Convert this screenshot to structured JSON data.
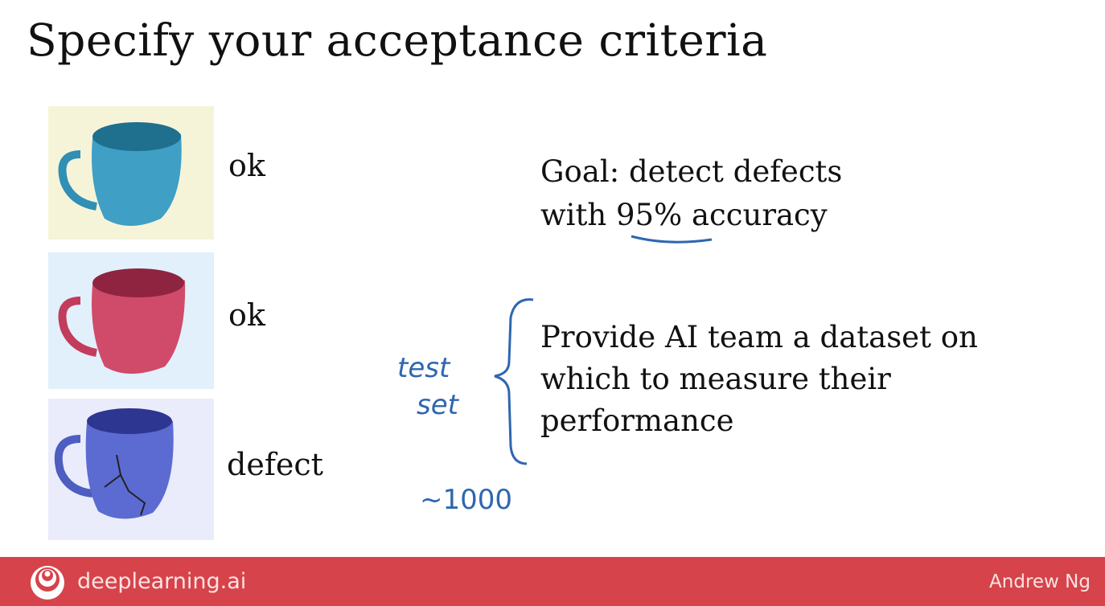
{
  "slide": {
    "title": "Specify your acceptance criteria",
    "examples": [
      {
        "label": "ok",
        "mug_color": "#3f9fc4",
        "background": "#f6f4d8"
      },
      {
        "label": "ok",
        "mug_color": "#d04a6a",
        "background": "#e1f0fb"
      },
      {
        "label": "defect",
        "mug_color": "#5b6bd2",
        "background": "#eaecfb"
      }
    ],
    "goal": {
      "line1": "Goal: detect defects",
      "line2_prefix": "with ",
      "line2_highlight": "95%",
      "line2_suffix": " accuracy"
    },
    "provide": {
      "line1": "Provide AI team a dataset on",
      "line2": "which to measure their",
      "line3": "performance"
    },
    "annotations": {
      "test": "test",
      "set": "set",
      "size": "~1000",
      "ink_color": "#2f66b0"
    }
  },
  "footer": {
    "brand": "deeplearning.ai",
    "author": "Andrew Ng",
    "color": "#d6434a"
  }
}
